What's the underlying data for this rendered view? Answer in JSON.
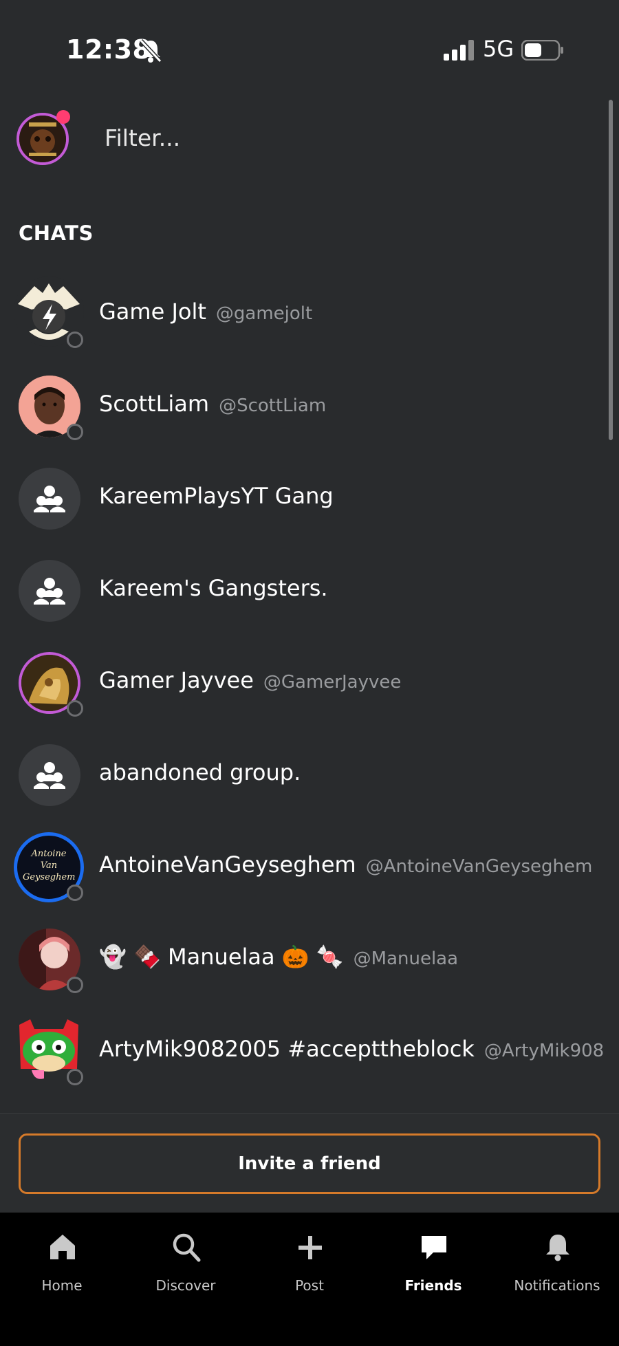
{
  "status_bar": {
    "time": "12:38",
    "network": "5G"
  },
  "filter": {
    "placeholder": "Filter..."
  },
  "section": {
    "title": "CHATS"
  },
  "chats": [
    {
      "name": "Game Jolt",
      "handle": "@gamejolt"
    },
    {
      "name": "ScottLiam",
      "handle": "@ScottLiam"
    },
    {
      "name": "KareemPlaysYT Gang"
    },
    {
      "name": "Kareem's Gangsters."
    },
    {
      "name": "Gamer Jayvee",
      "handle": "@GamerJayvee"
    },
    {
      "name": "abandoned group."
    },
    {
      "name": "AntoineVanGeyseghem",
      "handle": "@AntoineVanGeyseghem",
      "avatar_text": "Antoine Van Geyseghem"
    },
    {
      "name": "👻 🍫 Manuelaa 🎃 🍬",
      "handle": "@Manuelaa"
    },
    {
      "name": "ArtyMik9082005 #accepttheblock",
      "handle": "@ArtyMik908"
    }
  ],
  "invite": {
    "label": "Invite a friend"
  },
  "tabs": [
    {
      "label": "Home",
      "icon": "home-icon"
    },
    {
      "label": "Discover",
      "icon": "search-icon"
    },
    {
      "label": "Post",
      "icon": "plus-icon"
    },
    {
      "label": "Friends",
      "icon": "chat-bubble-icon",
      "active": true
    },
    {
      "label": "Notifications",
      "icon": "bell-icon"
    }
  ],
  "colors": {
    "background": "#292b2d",
    "accent": "#d57a2a",
    "tab_bar": "#000000",
    "avatar_ring": "#c35bd6",
    "notif_dot": "#ff3d71"
  }
}
